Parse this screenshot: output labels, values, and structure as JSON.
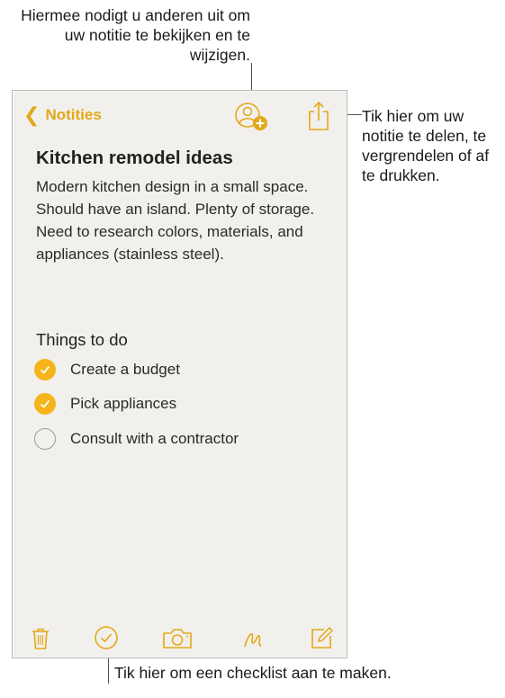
{
  "callouts": {
    "top": "Hiermee nodigt u anderen uit om uw notitie te bekijken en te wijzigen.",
    "right": "Tik hier om uw notitie te delen, te vergrendelen of af te drukken.",
    "bottom": "Tik hier om een checklist aan te maken."
  },
  "nav": {
    "back_label": "Notities",
    "icons": [
      "add-person-icon",
      "share-icon"
    ]
  },
  "note": {
    "title": "Kitchen remodel ideas",
    "body": "Modern kitchen design in a small space. Should have an island. Plenty of storage. Need to research colors, materials, and appliances (stainless steel).",
    "section_title": "Things to do",
    "checklist": [
      {
        "label": "Create a budget",
        "checked": true
      },
      {
        "label": "Pick appliances",
        "checked": true
      },
      {
        "label": "Consult with a contractor",
        "checked": false
      }
    ]
  },
  "toolbar": {
    "icons": [
      "trash-icon",
      "checklist-icon",
      "camera-icon",
      "sketch-icon",
      "compose-icon"
    ]
  },
  "colors": {
    "accent": "#e3a81a",
    "check_fill": "#f4b41a",
    "paper": "#f2f0ec"
  }
}
